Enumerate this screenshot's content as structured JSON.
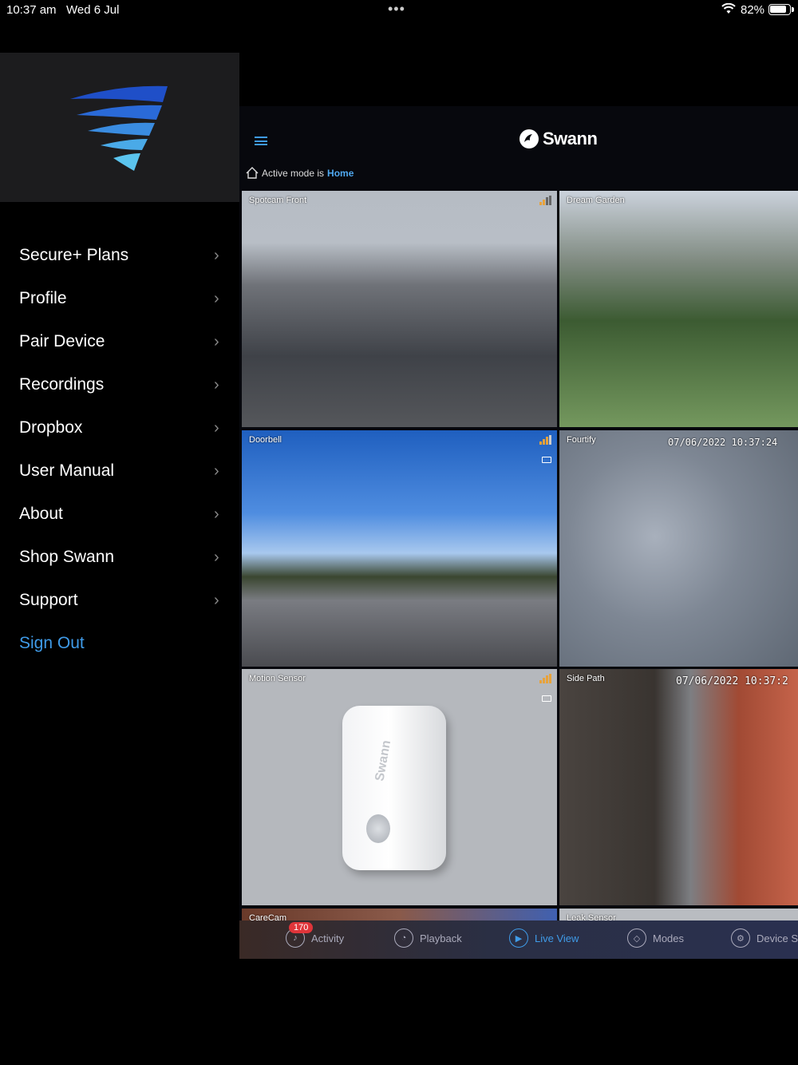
{
  "status_bar": {
    "time": "10:37 am",
    "date": "Wed 6 Jul",
    "battery_percent": "82%"
  },
  "side_menu": {
    "items": [
      {
        "label": "Secure+ Plans"
      },
      {
        "label": "Profile"
      },
      {
        "label": "Pair Device"
      },
      {
        "label": "Recordings"
      },
      {
        "label": "Dropbox"
      },
      {
        "label": "User Manual"
      },
      {
        "label": "About"
      },
      {
        "label": "Shop Swann"
      },
      {
        "label": "Support"
      }
    ],
    "sign_out": "Sign Out"
  },
  "header": {
    "brand": "Swann",
    "mode_prefix": "Active mode is",
    "mode_value": "Home"
  },
  "cameras": [
    {
      "name": "Spotcam Front",
      "timestamp": ""
    },
    {
      "name": "Dream Garden",
      "timestamp": ""
    },
    {
      "name": "Doorbell",
      "timestamp": ""
    },
    {
      "name": "Fourtify",
      "timestamp": "07/06/2022 10:37:24"
    },
    {
      "name": "Motion Sensor",
      "timestamp": ""
    },
    {
      "name": "Side Path",
      "timestamp": "07/06/2022 10:37:2"
    },
    {
      "name": "CareCam",
      "timestamp": ""
    },
    {
      "name": "Leak Sensor",
      "timestamp": ""
    }
  ],
  "sensor_brand_mark": "Swann",
  "tabs": {
    "activity": "Activity",
    "activity_badge": "170",
    "playback": "Playback",
    "live_view": "Live View",
    "modes": "Modes",
    "device": "Device S"
  },
  "colors": {
    "accent": "#3f9be8",
    "menu_background": "#000000",
    "logo_panel": "#1c1c1e",
    "badge": "#e0353a"
  }
}
